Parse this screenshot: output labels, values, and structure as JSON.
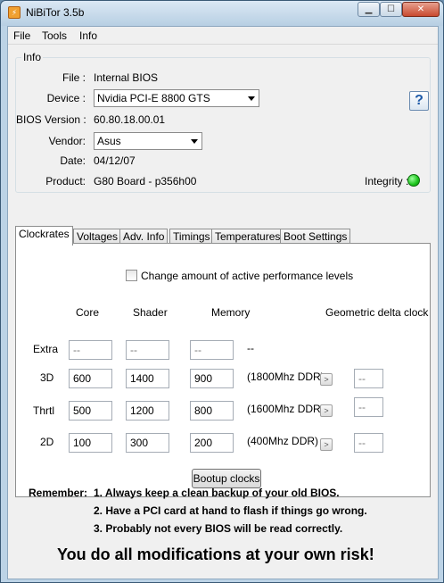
{
  "window": {
    "title": "NiBiTor 3.5b",
    "app_icon": "nibitor-app-icon",
    "controls": {
      "minimize": "▁",
      "maximize": "☐",
      "close": "✕"
    }
  },
  "menu": [
    "File",
    "Tools",
    "Info"
  ],
  "info": {
    "group_label": "Info",
    "file_label": "File :",
    "file_value": "Internal BIOS",
    "device_label": "Device :",
    "device_value": "Nvidia PCI-E 8800 GTS",
    "bios_version_label": "BIOS Version :",
    "bios_version_value": "60.80.18.00.01",
    "vendor_label": "Vendor:",
    "vendor_value": "Asus",
    "date_label": "Date:",
    "date_value": "04/12/07",
    "product_label": "Product:",
    "product_value": "G80 Board - p356h00",
    "integrity_label": "Integrity :",
    "integrity_color": "#22cc22",
    "help_label": "?"
  },
  "tabs": [
    "Clockrates",
    "Voltages",
    "Adv. Info",
    "Timings",
    "Temperatures",
    "Boot Settings"
  ],
  "clockrates": {
    "change_levels_label": "Change amount of active performance levels",
    "headers": {
      "core": "Core",
      "shader": "Shader",
      "memory": "Memory",
      "geometric": "Geometric delta clock"
    },
    "rows": [
      {
        "label": "Extra",
        "core": "--",
        "shader": "--",
        "memory": "--",
        "ddr": "--",
        "geo": ""
      },
      {
        "label": "3D",
        "core": "600",
        "shader": "1400",
        "memory": "900",
        "ddr": "(1800Mhz DDR)",
        "geo": "--"
      },
      {
        "label": "Thrtl",
        "core": "500",
        "shader": "1200",
        "memory": "800",
        "ddr": "(1600Mhz DDR)",
        "geo": "--"
      },
      {
        "label": "2D",
        "core": "100",
        "shader": "300",
        "memory": "200",
        "ddr": "(400Mhz DDR)",
        "geo": "--"
      }
    ],
    "arrow_button": ">",
    "bootup_button": "Bootup clocks"
  },
  "remember": {
    "label": "Remember:",
    "items": [
      "1. Always keep a clean backup of your old BIOS.",
      "2. Have a PCI card at hand to flash if things go wrong.",
      "3. Probably not every BIOS will be read correctly."
    ],
    "risk": "You do all modifications at your own risk!"
  }
}
